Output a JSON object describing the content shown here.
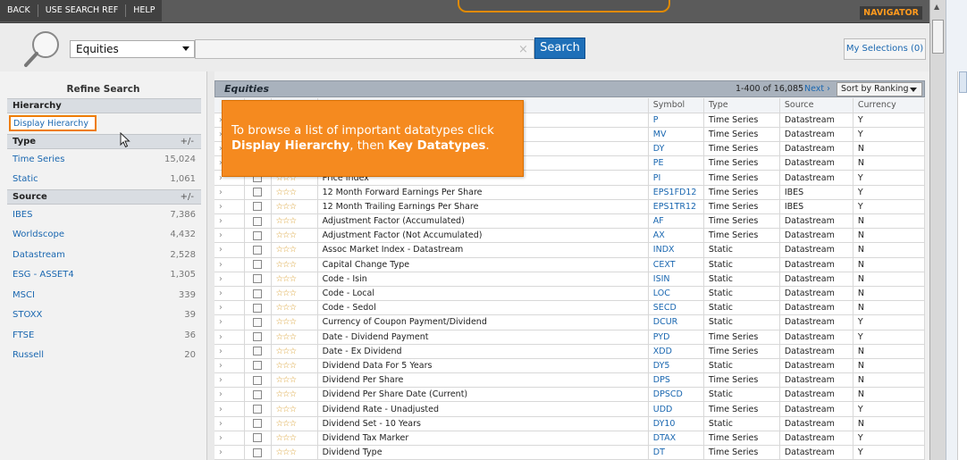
{
  "topnav": {
    "back": "BACK",
    "use_search_ref": "USE SEARCH REF",
    "help": "HELP",
    "navigator": "NAVIGATOR"
  },
  "search": {
    "category": "Equities",
    "query": "",
    "clear": "×",
    "button": "Search",
    "my_selections": "My Selections (0)"
  },
  "refine": {
    "title": "Refine Search",
    "hierarchy_head": "Hierarchy",
    "display_hierarchy": "Display Hierarchy",
    "type_head": "Type",
    "type_toggle": "+/-",
    "types": [
      {
        "name": "Time Series",
        "count": "15,024"
      },
      {
        "name": "Static",
        "count": "1,061"
      }
    ],
    "source_head": "Source",
    "source_toggle": "+/-",
    "sources": [
      {
        "name": "IBES",
        "count": "7,386"
      },
      {
        "name": "Worldscope",
        "count": "4,432"
      },
      {
        "name": "Datastream",
        "count": "2,528"
      },
      {
        "name": "ESG - ASSET4",
        "count": "1,305"
      },
      {
        "name": "MSCI",
        "count": "339"
      },
      {
        "name": "STOXX",
        "count": "39"
      },
      {
        "name": "FTSE",
        "count": "36"
      },
      {
        "name": "Russell",
        "count": "20"
      }
    ]
  },
  "results": {
    "title": "Equities",
    "range": "1-400 of 16,085",
    "next": "Next ›",
    "sort": "Sort by Ranking",
    "columns": {
      "symbol": "Symbol",
      "type": "Type",
      "source": "Source",
      "currency": "Currency"
    },
    "rows": [
      {
        "name": "",
        "symbol": "P",
        "type": "Time Series",
        "source": "Datastream",
        "currency": "Y"
      },
      {
        "name": "",
        "symbol": "MV",
        "type": "Time Series",
        "source": "Datastream",
        "currency": "Y"
      },
      {
        "name": "",
        "symbol": "DY",
        "type": "Time Series",
        "source": "Datastream",
        "currency": "N"
      },
      {
        "name": "",
        "symbol": "PE",
        "type": "Time Series",
        "source": "Datastream",
        "currency": "N"
      },
      {
        "name": "Price Index",
        "symbol": "PI",
        "type": "Time Series",
        "source": "Datastream",
        "currency": "Y"
      },
      {
        "name": "12 Month Forward Earnings Per Share",
        "symbol": "EPS1FD12",
        "type": "Time Series",
        "source": "IBES",
        "currency": "Y"
      },
      {
        "name": "12 Month Trailing Earnings Per Share",
        "symbol": "EPS1TR12",
        "type": "Time Series",
        "source": "IBES",
        "currency": "Y"
      },
      {
        "name": "Adjustment Factor (Accumulated)",
        "symbol": "AF",
        "type": "Time Series",
        "source": "Datastream",
        "currency": "N"
      },
      {
        "name": "Adjustment Factor (Not Accumulated)",
        "symbol": "AX",
        "type": "Time Series",
        "source": "Datastream",
        "currency": "N"
      },
      {
        "name": "Assoc Market Index - Datastream",
        "symbol": "INDX",
        "type": "Static",
        "source": "Datastream",
        "currency": "N"
      },
      {
        "name": "Capital Change Type",
        "symbol": "CEXT",
        "type": "Static",
        "source": "Datastream",
        "currency": "N"
      },
      {
        "name": "Code - Isin",
        "symbol": "ISIN",
        "type": "Static",
        "source": "Datastream",
        "currency": "N"
      },
      {
        "name": "Code - Local",
        "symbol": "LOC",
        "type": "Static",
        "source": "Datastream",
        "currency": "N"
      },
      {
        "name": "Code - Sedol",
        "symbol": "SECD",
        "type": "Static",
        "source": "Datastream",
        "currency": "N"
      },
      {
        "name": "Currency of Coupon Payment/Dividend",
        "symbol": "DCUR",
        "type": "Static",
        "source": "Datastream",
        "currency": "Y"
      },
      {
        "name": "Date - Dividend Payment",
        "symbol": "PYD",
        "type": "Time Series",
        "source": "Datastream",
        "currency": "Y"
      },
      {
        "name": "Date - Ex Dividend",
        "symbol": "XDD",
        "type": "Time Series",
        "source": "Datastream",
        "currency": "N"
      },
      {
        "name": "Dividend Data For 5 Years",
        "symbol": "DY5",
        "type": "Static",
        "source": "Datastream",
        "currency": "N"
      },
      {
        "name": "Dividend Per Share",
        "symbol": "DPS",
        "type": "Time Series",
        "source": "Datastream",
        "currency": "N"
      },
      {
        "name": "Dividend Per Share Date (Current)",
        "symbol": "DPSCD",
        "type": "Static",
        "source": "Datastream",
        "currency": "N"
      },
      {
        "name": "Dividend Rate - Unadjusted",
        "symbol": "UDD",
        "type": "Time Series",
        "source": "Datastream",
        "currency": "Y"
      },
      {
        "name": "Dividend Set - 10 Years",
        "symbol": "DY10",
        "type": "Static",
        "source": "Datastream",
        "currency": "N"
      },
      {
        "name": "Dividend Tax Marker",
        "symbol": "DTAX",
        "type": "Time Series",
        "source": "Datastream",
        "currency": "Y"
      },
      {
        "name": "Dividend Type",
        "symbol": "DT",
        "type": "Time Series",
        "source": "Datastream",
        "currency": "Y"
      }
    ]
  },
  "callout": {
    "line1": "To browse a list of important datatypes click",
    "link1": "Display Hierarchy",
    "mid": ", then ",
    "link2": "Key Datatypes",
    "end": "."
  },
  "glyphs": {
    "expander": "›",
    "stars": "☆☆☆",
    "scroll_up": "▲"
  }
}
